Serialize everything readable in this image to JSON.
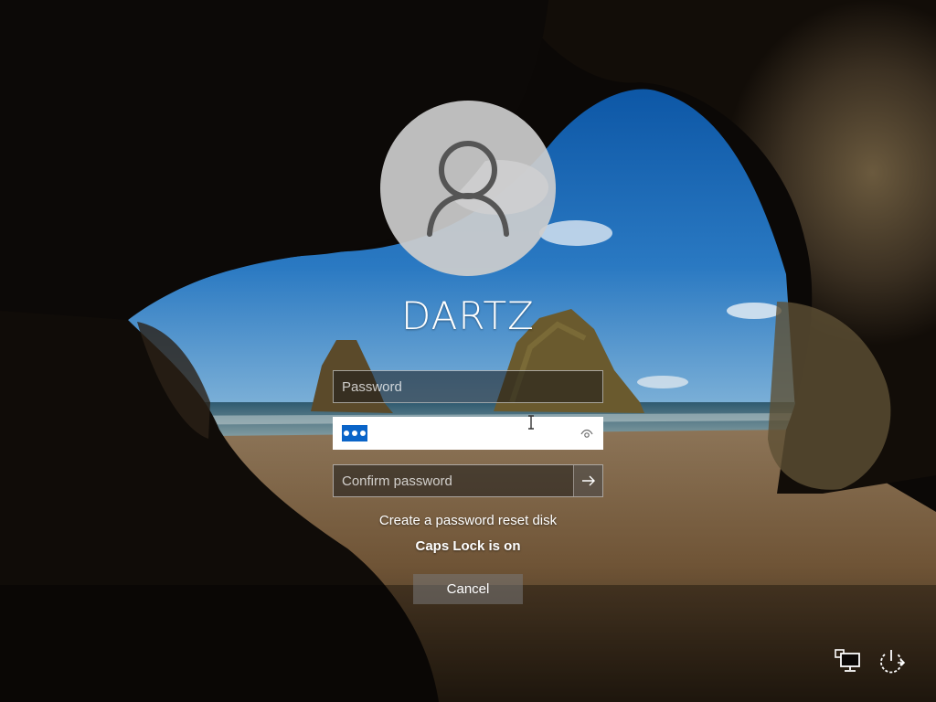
{
  "user": {
    "name": "DARTZ",
    "avatar_icon": "user-silhouette-icon"
  },
  "fields": {
    "password_placeholder": "Password",
    "confirm_placeholder": "Confirm password",
    "reveal_icon": "eye-icon",
    "submit_icon": "arrow-right-icon",
    "entered_dot_count": 3
  },
  "links": {
    "reset_disk": "Create a password reset disk"
  },
  "status": {
    "caps_lock": "Caps Lock is on"
  },
  "buttons": {
    "cancel": "Cancel"
  },
  "corner_icons": {
    "network": "network-icon",
    "power": "power-icon"
  },
  "colors": {
    "selection_blue": "#0a64c8",
    "text": "#ffffff"
  }
}
